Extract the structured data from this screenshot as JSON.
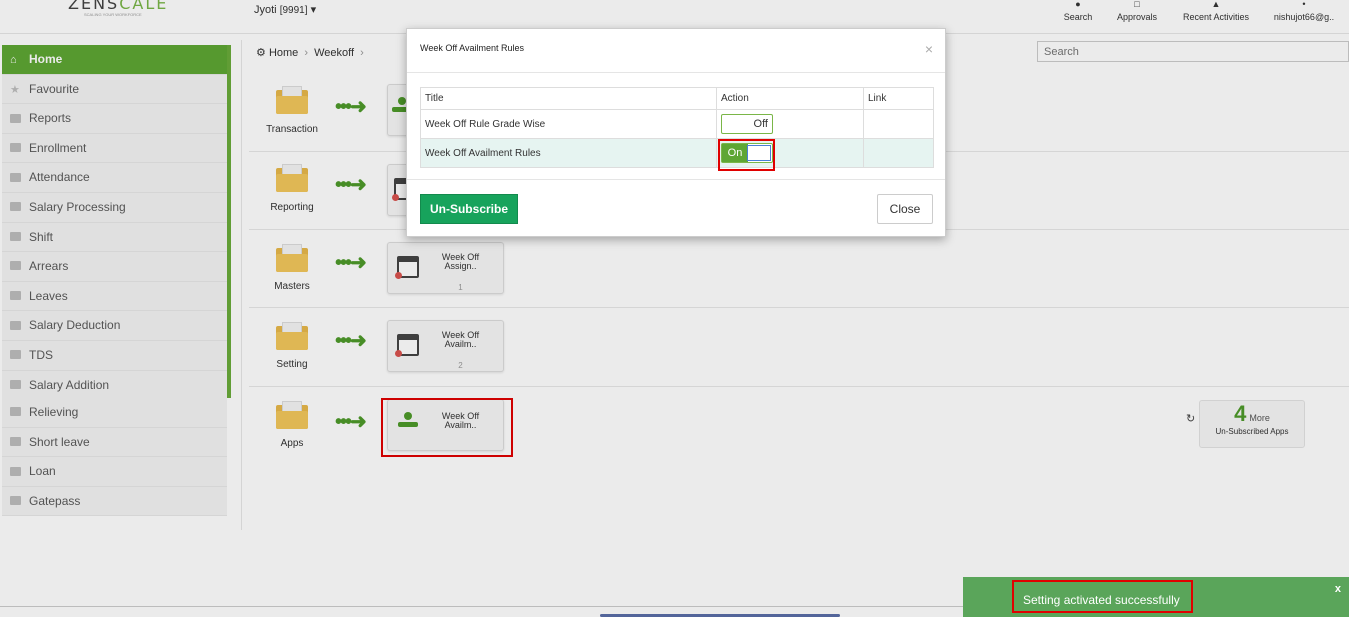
{
  "header": {
    "logo_text": "ZENSCALE",
    "logo_highlight": "CALE",
    "logo_prefix": "ZENS",
    "tagline": "SCALING YOUR WORKFORCE",
    "user": "Jyoti",
    "user_code": "[9991]",
    "actions": [
      {
        "label": "Search",
        "icon": "search-icon"
      },
      {
        "label": "Approvals",
        "icon": "clipboard-icon"
      },
      {
        "label": "Recent Activities",
        "icon": "bell-icon"
      },
      {
        "label": "nishujot66@g..",
        "icon": "user-icon"
      }
    ]
  },
  "sidebar": {
    "items": [
      {
        "label": "Home",
        "icon": "home-icon",
        "active": true
      },
      {
        "label": "Favourite",
        "icon": "star-icon"
      },
      {
        "label": "Reports",
        "icon": "folder-icon"
      },
      {
        "label": "Enrollment",
        "icon": "folder-icon"
      },
      {
        "label": "Attendance",
        "icon": "folder-icon"
      },
      {
        "label": "Salary Processing",
        "icon": "folder-icon"
      },
      {
        "label": "Shift",
        "icon": "folder-icon"
      },
      {
        "label": "Arrears",
        "icon": "folder-icon"
      },
      {
        "label": "Leaves",
        "icon": "folder-icon"
      },
      {
        "label": "Salary Deduction",
        "icon": "folder-icon"
      },
      {
        "label": "TDS",
        "icon": "folder-icon"
      },
      {
        "label": "Salary Addition",
        "icon": "folder-icon"
      },
      {
        "label": "Relieving",
        "icon": "folder-icon"
      },
      {
        "label": "Short leave",
        "icon": "folder-icon"
      },
      {
        "label": "Loan",
        "icon": "folder-icon"
      },
      {
        "label": "Gatepass",
        "icon": "folder-icon"
      }
    ]
  },
  "breadcrumb": {
    "home": "Home",
    "current": "Weekoff"
  },
  "search": {
    "placeholder": "Search"
  },
  "rows": [
    {
      "label": "Transaction"
    },
    {
      "label": "Reporting"
    },
    {
      "label": "Masters",
      "tile": {
        "name": "Week Off Assign..",
        "count": "1"
      }
    },
    {
      "label": "Setting",
      "tile": {
        "name": "Week Off Availm..",
        "count": "2"
      }
    },
    {
      "label": "Apps",
      "tile": {
        "name": "Week Off Availm.."
      }
    }
  ],
  "unsubscribed": {
    "count": "4",
    "more": "More",
    "label": "Un-Subscribed Apps"
  },
  "modal": {
    "title": "Week Off Availment Rules",
    "columns": [
      "Title",
      "Action",
      "Link"
    ],
    "rules": [
      {
        "title": "Week Off Rule Grade Wise",
        "state": "Off"
      },
      {
        "title": "Week Off Availment Rules",
        "state": "On"
      }
    ],
    "unsubscribe_label": "Un-Subscribe",
    "close_label": "Close"
  },
  "toast": {
    "message": "Setting activated successfully",
    "close": "x"
  },
  "colors": {
    "accent": "#5ea634",
    "toast": "#5aa55a",
    "highlight": "#e00000",
    "button": "#17a35c"
  }
}
